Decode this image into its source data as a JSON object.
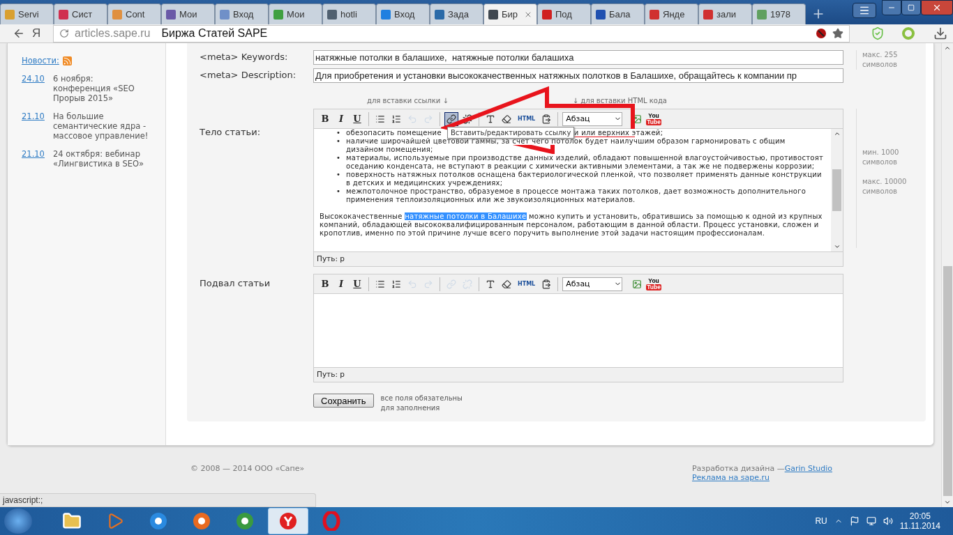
{
  "browser": {
    "tabs": [
      {
        "label": "Servi",
        "selected": false,
        "color": "#d9a030"
      },
      {
        "label": "Сист",
        "selected": false,
        "color": "#d03050"
      },
      {
        "label": "Cont",
        "selected": false,
        "color": "#e09040"
      },
      {
        "label": "Мои",
        "selected": false,
        "color": "#6a5aa8"
      },
      {
        "label": "Вход",
        "selected": false,
        "color": "#7090c8"
      },
      {
        "label": "Мои",
        "selected": false,
        "color": "#40a040"
      },
      {
        "label": "hotli",
        "selected": false,
        "color": "#506070"
      },
      {
        "label": "Вход",
        "selected": false,
        "color": "#2080e0"
      },
      {
        "label": "Зада",
        "selected": false,
        "color": "#2a6aa8"
      },
      {
        "label": "Бир",
        "selected": true,
        "color": "#404850"
      },
      {
        "label": "Под",
        "selected": false,
        "color": "#d02020"
      },
      {
        "label": "Бала",
        "selected": false,
        "color": "#2050b0"
      },
      {
        "label": "Янде",
        "selected": false,
        "color": "#d03030"
      },
      {
        "label": "зали",
        "selected": false,
        "color": "#d03030"
      },
      {
        "label": "1978",
        "selected": false,
        "color": "#60a060"
      }
    ],
    "yandex_key": "Я",
    "url": "articles.sape.ru",
    "page_title": "Биржа Статей SAPE"
  },
  "sidebar": {
    "news_link": "Новости:",
    "items": [
      {
        "date": "24.10",
        "text": "6 ноября: конференция «SEO Прорыв 2015»"
      },
      {
        "date": "21.10",
        "text": "На большие семантические ядра - массовое управление!"
      },
      {
        "date": "21.10",
        "text": "24 октября: вебинар «Лингвистика в SEO»"
      }
    ]
  },
  "form": {
    "meta": [
      {
        "label": "<meta> Keywords:",
        "value": "натяжные потолки в балашихе,  натяжные потолки балашиха"
      },
      {
        "label": "<meta> Description:",
        "value": "Для приобретения и установки высококачественных натяжных полотков в Балашихе, обращайтесь к компании пр"
      }
    ],
    "meta_hint": [
      "макс. 255",
      "символов"
    ],
    "editor_hints": [
      "для вставки ссылки ↓",
      "↓ для вставки HTML кода"
    ],
    "editors": [
      {
        "label": "Тело статьи:",
        "path": "Путь: p",
        "format": "Абзац",
        "tooltip": "Вставить/редактировать ссылку",
        "tools": [
          {
            "kind": "bold",
            "label": "B",
            "disabled": false,
            "active": false
          },
          {
            "kind": "italic",
            "label": "I",
            "disabled": false,
            "active": false
          },
          {
            "kind": "underline",
            "label": "U",
            "disabled": false,
            "active": false
          },
          {
            "kind": "sep"
          },
          {
            "kind": "bullets",
            "disabled": false,
            "active": false
          },
          {
            "kind": "numbers",
            "disabled": false,
            "active": false
          },
          {
            "kind": "undo",
            "disabled": true,
            "active": false
          },
          {
            "kind": "redo",
            "disabled": true,
            "active": false
          },
          {
            "kind": "sep"
          },
          {
            "kind": "link",
            "disabled": false,
            "active": true
          },
          {
            "kind": "unlink",
            "disabled": false,
            "active": false
          },
          {
            "kind": "sep"
          },
          {
            "kind": "spell"
          },
          {
            "kind": "eraser",
            "disabled": false,
            "active": false
          },
          {
            "kind": "html",
            "label": "HTML",
            "disabled": false,
            "active": false
          },
          {
            "kind": "paste",
            "disabled": false,
            "active": false
          },
          {
            "kind": "sep"
          },
          {
            "kind": "select"
          },
          {
            "kind": "image",
            "disabled": false,
            "active": false
          },
          {
            "kind": "youtube",
            "label": "You",
            "label2": "Tube",
            "disabled": false,
            "active": false
          }
        ],
        "bullets": [
          {
            "marker": "•",
            "text": "обезопасить помещение",
            "text_after": "и или верхних этажей;"
          },
          {
            "marker": "•",
            "text": "наличие широчайшей цветовой гаммы, за счет чего потолок будет наилучшим образом гармонировать с общим дизайном помещения;"
          },
          {
            "marker": "•",
            "text": "материалы, используемые при производстве данных изделий, обладают повышенной влагоустойчивостью, противостоят оседанию конденсата, не вступают в реакции с химически активными элементами, а так же не подвержены коррозии;"
          },
          {
            "marker": "•",
            "text": "поверхность натяжных потолков оснащена бактериологической пленкой, что позволяет применять данные конструкции в детских и медицинских учреждениях;"
          },
          {
            "marker": "•",
            "text": "межпотолочное пространство, образуемое в процессе монтажа таких потолков, дает возможность дополнительного применения теплоизоляционных или же звукоизоляционных материалов."
          }
        ],
        "paragraph": [
          {
            "text": "Высококачественные ",
            "selected": false
          },
          {
            "text": "натяжные потолки в Балашихе",
            "selected": true
          },
          {
            "text": " можно купить и установить, обратившись за помощью к одной из крупных компаний, обладающей высококвалифицированным персоналом, работающим в данной области. Процесс установки, сложен и кропотлив, именно по этой причине лучше всего поручить выполнение этой задачи настоящим профессионалам.",
            "selected": false
          }
        ],
        "hints": [
          [
            "мин. 1000",
            "символов"
          ],
          [
            "макс. 10000",
            "символов"
          ]
        ]
      },
      {
        "label": "Подвал статьи",
        "path": "Путь: p",
        "format": "Абзац",
        "tools": [
          {
            "kind": "bold",
            "label": "B",
            "disabled": false,
            "active": false
          },
          {
            "kind": "italic",
            "label": "I",
            "disabled": false,
            "active": false
          },
          {
            "kind": "underline",
            "label": "U",
            "disabled": false,
            "active": false
          },
          {
            "kind": "sep"
          },
          {
            "kind": "bullets",
            "disabled": false,
            "active": false
          },
          {
            "kind": "numbers",
            "disabled": false,
            "active": false
          },
          {
            "kind": "undo",
            "disabled": true,
            "active": false
          },
          {
            "kind": "redo",
            "disabled": true,
            "active": false
          },
          {
            "kind": "sep"
          },
          {
            "kind": "link",
            "disabled": true,
            "active": false
          },
          {
            "kind": "unlink",
            "disabled": true,
            "active": false
          },
          {
            "kind": "sep"
          },
          {
            "kind": "spell"
          },
          {
            "kind": "eraser",
            "disabled": false,
            "active": false
          },
          {
            "kind": "html",
            "label": "HTML",
            "disabled": false,
            "active": false
          },
          {
            "kind": "paste",
            "disabled": false,
            "active": false
          },
          {
            "kind": "sep"
          },
          {
            "kind": "select"
          },
          {
            "kind": "image",
            "disabled": false,
            "active": false
          },
          {
            "kind": "youtube",
            "label": "You",
            "label2": "Tube",
            "disabled": false,
            "active": false
          }
        ]
      }
    ],
    "save_button": "Сохранить",
    "required_note": "все поля обязательны для заполнения"
  },
  "footer": {
    "copyright": "© 2008 — 2014 ООО «Сапе»",
    "design_text": "Разработка дизайна — ",
    "design_link": "Garin Studio",
    "ad_link": "Реклама на sape.ru"
  },
  "status_url": "javascript:;",
  "taskbar": {
    "apps": [
      {
        "kind": "folder",
        "selected": false
      },
      {
        "kind": "media",
        "selected": false
      },
      {
        "kind": "ie",
        "selected": false
      },
      {
        "kind": "firefox",
        "selected": false
      },
      {
        "kind": "chrome",
        "selected": false
      },
      {
        "kind": "yandex",
        "selected": true
      },
      {
        "kind": "opera",
        "selected": false
      }
    ],
    "lang": "RU",
    "time": "20:05",
    "date": "11.11.2014"
  }
}
